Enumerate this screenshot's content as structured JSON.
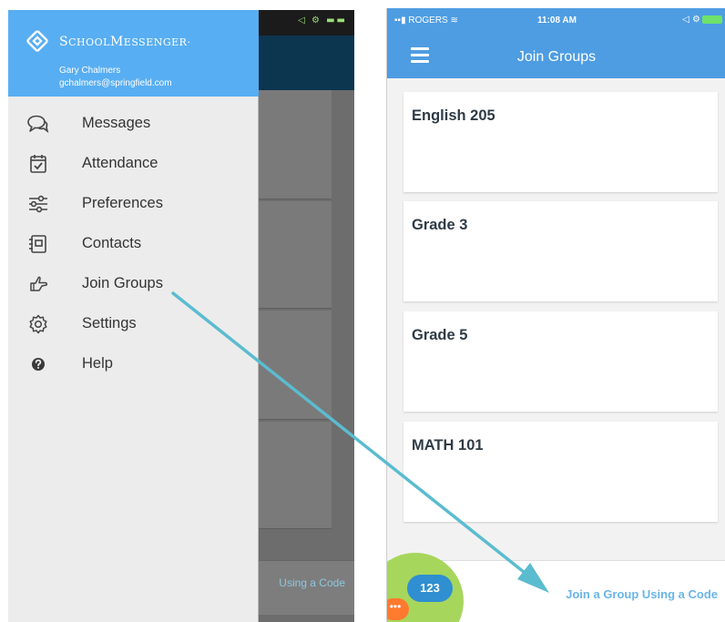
{
  "left_phone": {
    "status_glyphs": "◁ ⚙ ▬▬",
    "drawer": {
      "brand": {
        "prefix_s": "S",
        "rest_chool": "CHOOL",
        "prefix_m": "M",
        "rest_essenger": "ESSENGER",
        "mark": "·"
      },
      "user": {
        "name": "Gary Chalmers",
        "email": "gchalmers@springfield.com"
      },
      "menu": [
        {
          "label": "Messages",
          "icon": "chat-bubbles-icon"
        },
        {
          "label": "Attendance",
          "icon": "calendar-check-icon"
        },
        {
          "label": "Preferences",
          "icon": "sliders-icon"
        },
        {
          "label": "Contacts",
          "icon": "address-book-icon"
        },
        {
          "label": "Join Groups",
          "icon": "pointing-hand-icon"
        },
        {
          "label": "Settings",
          "icon": "gear-icon"
        },
        {
          "label": "Help",
          "icon": "help-circle-icon"
        }
      ]
    },
    "background_partial_text": "Using a Code"
  },
  "right_phone": {
    "status": {
      "carrier": "▪▪▮ ROGERS ≋",
      "time": "11:08 AM",
      "icons": "◁ ⚙"
    },
    "appbar": {
      "title": "Join Groups"
    },
    "groups": [
      {
        "name": "English 205"
      },
      {
        "name": "Grade 3"
      },
      {
        "name": "Grade 5"
      },
      {
        "name": "MATH 101"
      }
    ],
    "footer": {
      "join_code_label": "Join a Group Using a Code"
    },
    "fab": {
      "label": "123",
      "dots": "•••"
    }
  },
  "colors": {
    "drawer_header": "#58aef2",
    "appbar": "#4e9de2",
    "arrow": "#5bbcd0",
    "link": "#6ab5e8",
    "fab_green": "#a7d65c",
    "fab_blue": "#2f8fd0"
  }
}
